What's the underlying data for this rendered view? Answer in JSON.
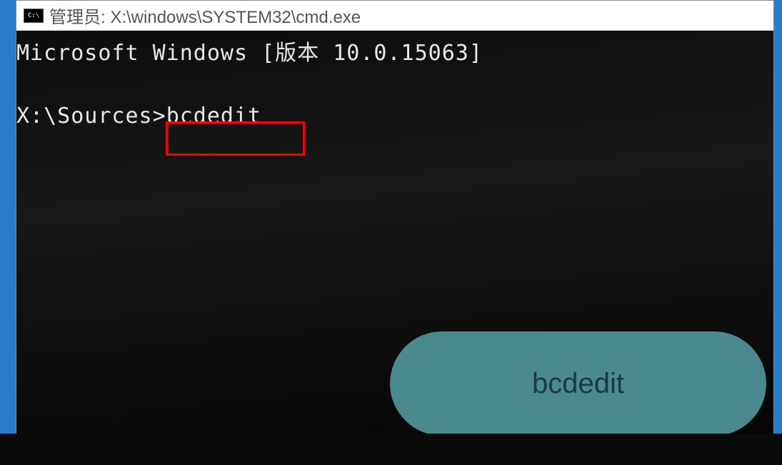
{
  "window": {
    "icon_label": "C:\\",
    "title": "管理员: X:\\windows\\SYSTEM32\\cmd.exe"
  },
  "console": {
    "version_line": "Microsoft Windows [版本 10.0.15063]",
    "prompt": "X:\\Sources>",
    "command": "bcdedit"
  },
  "annotation": {
    "pill_label": "bcdedit"
  }
}
